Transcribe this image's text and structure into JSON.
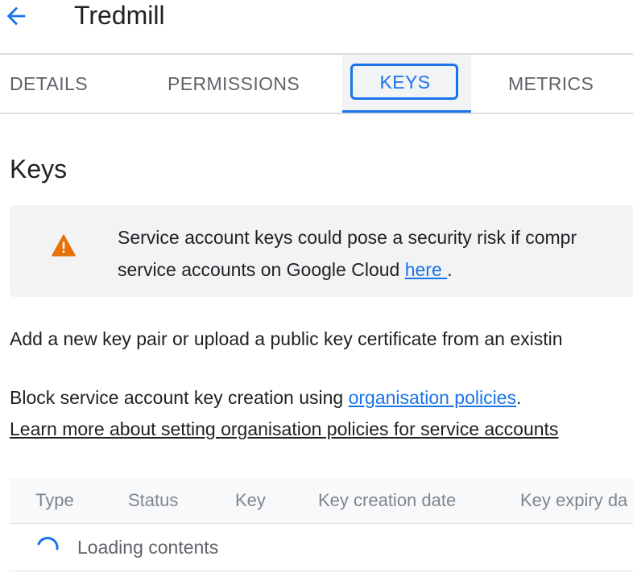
{
  "header": {
    "title": "Tredmill"
  },
  "tabs": [
    {
      "label": "DETAILS",
      "active": false
    },
    {
      "label": "PERMISSIONS",
      "active": false
    },
    {
      "label": "KEYS",
      "active": true
    },
    {
      "label": "METRICS",
      "active": false
    }
  ],
  "section": {
    "heading": "Keys"
  },
  "banner": {
    "line1": "Service account keys could pose a security risk if compr",
    "line2_prefix": "service accounts on Google Cloud ",
    "line2_link": "here ",
    "line2_suffix": "."
  },
  "paragraphs": {
    "add_key": "Add a new key pair or upload a public key certificate from an existin",
    "block_prefix": "Block service account key creation using ",
    "block_link": "organisation policies",
    "block_suffix": ".",
    "learn_more_link": "Learn more about setting organisation policies for service accounts"
  },
  "table": {
    "columns": [
      "Type",
      "Status",
      "Key",
      "Key creation date",
      "Key expiry da"
    ],
    "loading_text": "Loading contents"
  },
  "colors": {
    "accent": "#1a73e8",
    "warning": "#e8710a",
    "banner_bg": "#f1f3f4"
  },
  "icons": {
    "back": "arrow-back-icon",
    "warning": "warning-icon",
    "spinner": "loading-spinner-icon"
  }
}
